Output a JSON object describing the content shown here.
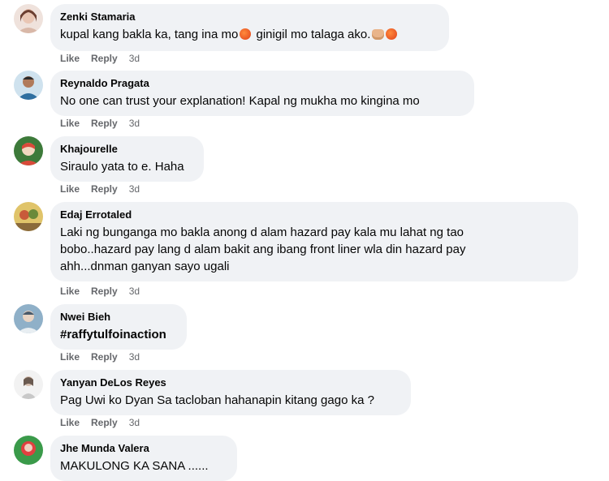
{
  "comments": [
    {
      "author": "Zenki Stamaria",
      "text_main": "kupal kang bakla ka, tang ina mo",
      "text_mid": " ginigil mo talaga ako.",
      "emoji_angry": "angry-face-icon",
      "emoji_fist": "fist-icon",
      "like": "Like",
      "reply": "Reply",
      "time": "3d",
      "avatar_colors": [
        "#d9b8a8",
        "#f2d6c9",
        "#8a5a48"
      ]
    },
    {
      "author": "Reynaldo Pragata",
      "text": "No one can trust your explanation! Kapal ng mukha mo kingina mo",
      "like": "Like",
      "reply": "Reply",
      "time": "3d",
      "avatar_colors": [
        "#7fb3d6",
        "#d8e8f2",
        "#2f6fa0"
      ]
    },
    {
      "author": "Khajourelle",
      "text": "Siraulo yata to e. Haha",
      "like": "Like",
      "reply": "Reply",
      "time": "3d",
      "avatar_colors": [
        "#3d7a3a",
        "#d94a3a",
        "#f0e0c8"
      ]
    },
    {
      "author": "Edaj Errotaled",
      "text_lines": [
        "Laki ng bunganga mo bakla anong d alam hazard pay kala mu lahat ng tao",
        "bobo..hazard pay lang d alam bakit ang ibang front liner wla din hazard pay",
        "ahh...dnman ganyan sayo ugali"
      ],
      "like": "Like",
      "reply": "Reply",
      "time": "3d",
      "avatar_colors": [
        "#e0c46a",
        "#6a8a3a",
        "#c85a3a"
      ]
    },
    {
      "author": "Nwei Bieh",
      "text": "#raffytulfoinaction",
      "like": "Like",
      "reply": "Reply",
      "time": "3d",
      "avatar_colors": [
        "#8fb0c8",
        "#e8eef2",
        "#4a5a6a"
      ]
    },
    {
      "author": "Yanyan DeLos Reyes",
      "text": "Pag Uwi ko Dyan Sa tacloban hahanapin kitang gago ka ?",
      "like": "Like",
      "reply": "Reply",
      "time": "3d",
      "avatar_colors": [
        "#f2f2f2",
        "#c8c8c8",
        "#6a5a50"
      ]
    },
    {
      "author": "Jhe Munda Valera",
      "text": "MAKULONG KA SANA ......",
      "avatar_colors": [
        "#e04040",
        "#3a9a4a",
        "#f0d0c0"
      ]
    }
  ]
}
